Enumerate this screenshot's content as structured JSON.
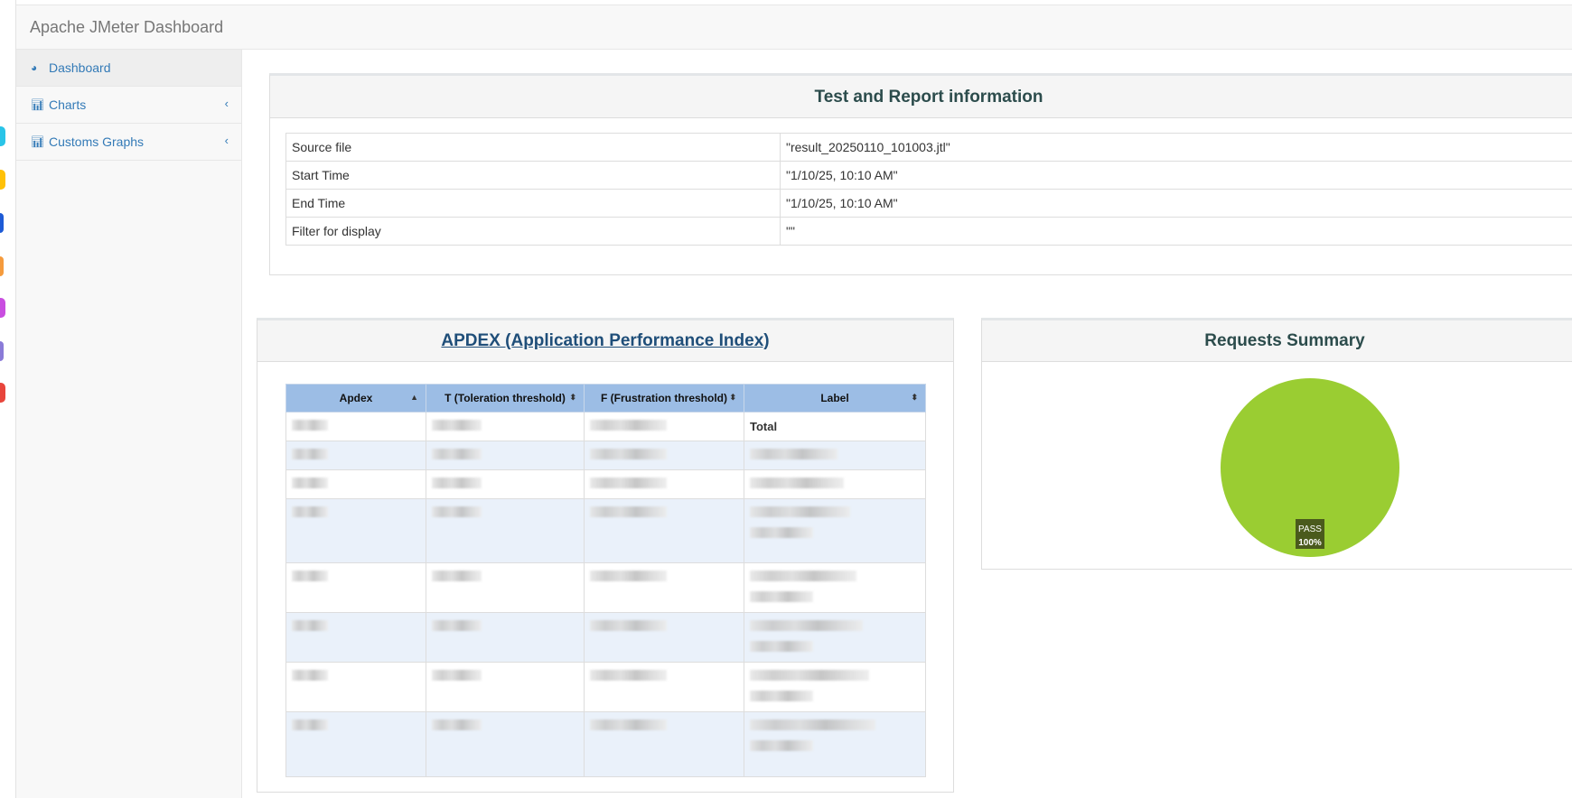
{
  "app": {
    "title": "Apache JMeter Dashboard"
  },
  "sidebar": {
    "items": [
      {
        "label": "Dashboard",
        "icon": "dashboard-icon",
        "active": true
      },
      {
        "label": "Charts",
        "icon": "bar-chart-icon",
        "chevron": "chevron-left-icon"
      },
      {
        "label": "Customs Graphs",
        "icon": "bar-chart-icon",
        "chevron": "chevron-left-icon"
      }
    ]
  },
  "test_info": {
    "title": "Test and Report information",
    "rows": [
      {
        "label": "Source file",
        "value": "\"result_20250110_101003.jtl\""
      },
      {
        "label": "Start Time",
        "value": "\"1/10/25, 10:10 AM\""
      },
      {
        "label": "End Time",
        "value": "\"1/10/25, 10:10 AM\""
      },
      {
        "label": "Filter for display",
        "value": "\"\""
      }
    ]
  },
  "apdex": {
    "title": "APDEX (Application Performance Index)",
    "columns": [
      "Apdex",
      "T (Toleration threshold)",
      "F (Frustration threshold)",
      "Label"
    ],
    "total_label": "Total"
  },
  "requests_summary": {
    "title": "Requests Summary",
    "chart_data": {
      "type": "pie",
      "slices": [
        {
          "label": "PASS",
          "value": 100,
          "percent_label": "100%",
          "color": "#9acd32"
        }
      ]
    }
  }
}
